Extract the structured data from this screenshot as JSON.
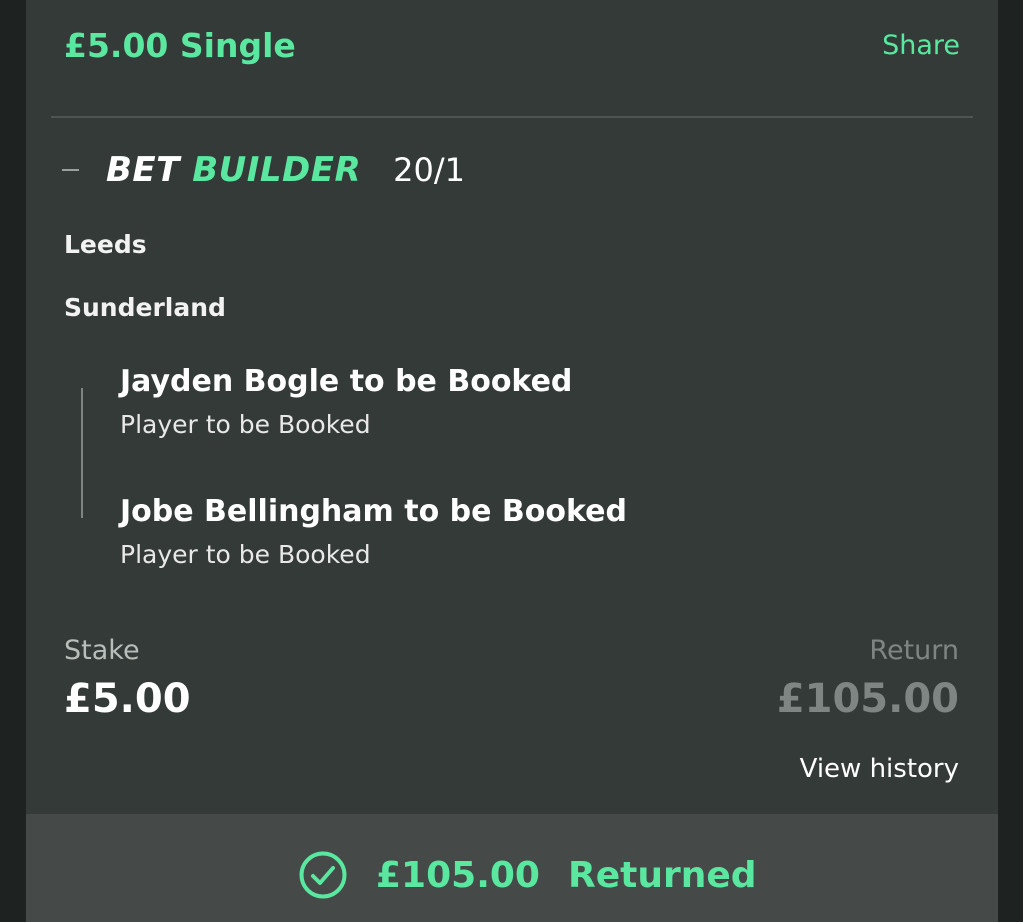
{
  "bet": {
    "title": "£5.00 Single",
    "share_label": "Share"
  },
  "bet_builder": {
    "logo_bet": "BET",
    "logo_builder": "BUILDER",
    "odds": "20/1"
  },
  "match": {
    "home_team": "Leeds",
    "away_team": "Sunderland"
  },
  "selections": [
    {
      "name": "Jayden Bogle to be Booked",
      "market": "Player to be Booked"
    },
    {
      "name": "Jobe Bellingham to be Booked",
      "market": "Player to be Booked"
    }
  ],
  "stake": {
    "label": "Stake",
    "value": "£5.00"
  },
  "return": {
    "label": "Return",
    "value": "£105.00"
  },
  "view_history_label": "View history",
  "result": {
    "amount": "£105.00",
    "label": "Returned",
    "icon": "check-circle-icon"
  },
  "colors": {
    "accent": "#5ae8a0",
    "card_background": "#343a37",
    "footer_background": "#454a48"
  }
}
